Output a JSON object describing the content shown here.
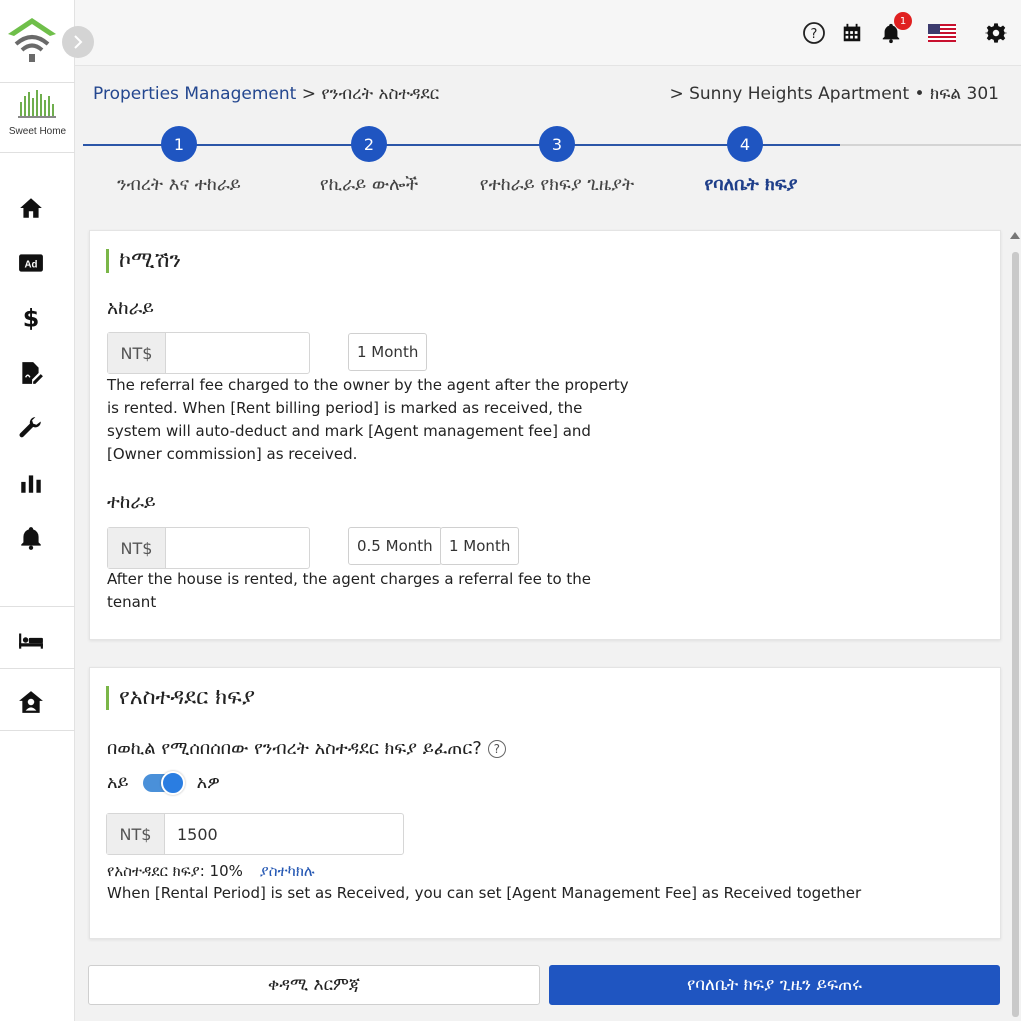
{
  "app": {
    "logo_text": "Sweet Home"
  },
  "topbar": {
    "notification_count": "1"
  },
  "breadcrumb": {
    "root": "Properties Management",
    "sep": ">",
    "current": "የንብረት አስተዳደር",
    "right": "> Sunny Heights Apartment • ክፍል 301"
  },
  "stepper": {
    "steps": [
      {
        "num": "1",
        "label": "ንብረት እና ተከራይ"
      },
      {
        "num": "2",
        "label": "የኪራይ ውሎች"
      },
      {
        "num": "3",
        "label": "የተከራይ የክፍያ ጊዜያት"
      },
      {
        "num": "4",
        "label": "የባለቤት ክፍያ"
      }
    ],
    "active": 4
  },
  "commission": {
    "title": "ኮሚሽን",
    "landlord": {
      "label": "አከራይ",
      "prefix": "NT$",
      "value": "",
      "chips": [
        "1 Month"
      ],
      "desc_lines": [
        "The referral fee charged to the owner by the agent after the property",
        "is rented. When [Rent billing period] is marked as received, the",
        "system will auto-deduct and mark [Agent management fee] and",
        "[Owner commission] as received."
      ]
    },
    "tenant": {
      "label": "ተከራይ",
      "prefix": "NT$",
      "value": "",
      "chips": [
        "0.5 Month",
        "1 Month"
      ],
      "desc_lines": [
        "After the house is rented, the agent charges a referral fee to the",
        "tenant"
      ]
    }
  },
  "management": {
    "title": "የአስተዳደር ክፍያ",
    "question": "በወኪል የሚሰበሰበው የንብረት አስተዳደር ክፍያ ይፈጠር?",
    "toggle_off": "አይ",
    "toggle_on": "አዎ",
    "toggle_value": true,
    "prefix": "NT$",
    "value": "1500",
    "fee_label": "የአስተዳደር ክፍያ: 10%",
    "adjust_link": "ያስተካክሉ",
    "note": "When [Rental Period] is set as Received, you can set [Agent Management Fee] as Received together"
  },
  "footer": {
    "prev_label": "ቀዳሚ እርምጃ",
    "generate_label": "የባለቤት ክፍያ ጊዜን ይፍጠሩ"
  },
  "colors": {
    "primary": "#1f55c1",
    "accent_green": "#7ab648",
    "link": "#2457b3"
  }
}
